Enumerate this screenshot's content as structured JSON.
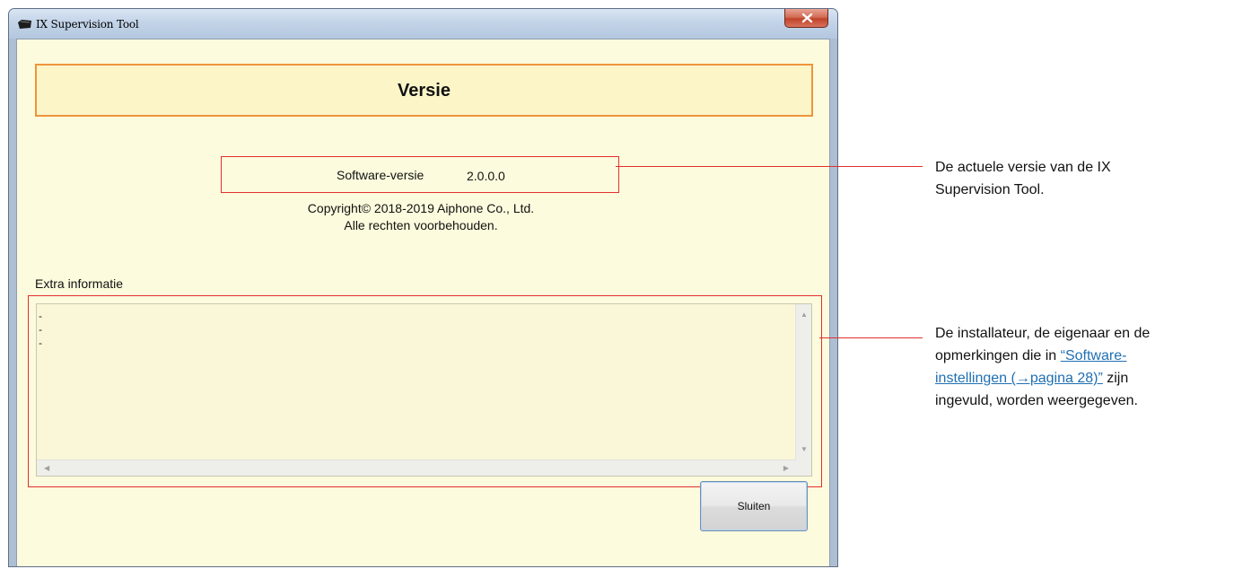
{
  "window": {
    "title": "IX Supervision Tool",
    "close_icon": "close-icon"
  },
  "header": {
    "title": "Versie"
  },
  "version": {
    "label": "Software-versie",
    "value": "2.0.0.0"
  },
  "copyright": {
    "line1": "Copyright© 2018-2019 Aiphone Co., Ltd.",
    "line2": "Alle rechten voorbehouden."
  },
  "extra": {
    "label": "Extra informatie",
    "lines": "-\n-\n-"
  },
  "buttons": {
    "close_label": "Sluiten"
  },
  "annotations": {
    "version_note": {
      "line1": "De actuele versie van de IX",
      "line2": "Supervision Tool."
    },
    "info_note": {
      "line1": "De installateur, de eigenaar en de",
      "line2_text": "opmerkingen die in ",
      "link_part1": "“Software-",
      "link_part2": "instellingen (→pagina 28)”",
      "line3_tail": " zijn",
      "line4": "ingevuld, worden weergegeven."
    }
  },
  "colors": {
    "highlight": "#e0302e",
    "header_border": "#f0943c",
    "link": "#1f6fb2",
    "background": "#fdfbdd"
  }
}
